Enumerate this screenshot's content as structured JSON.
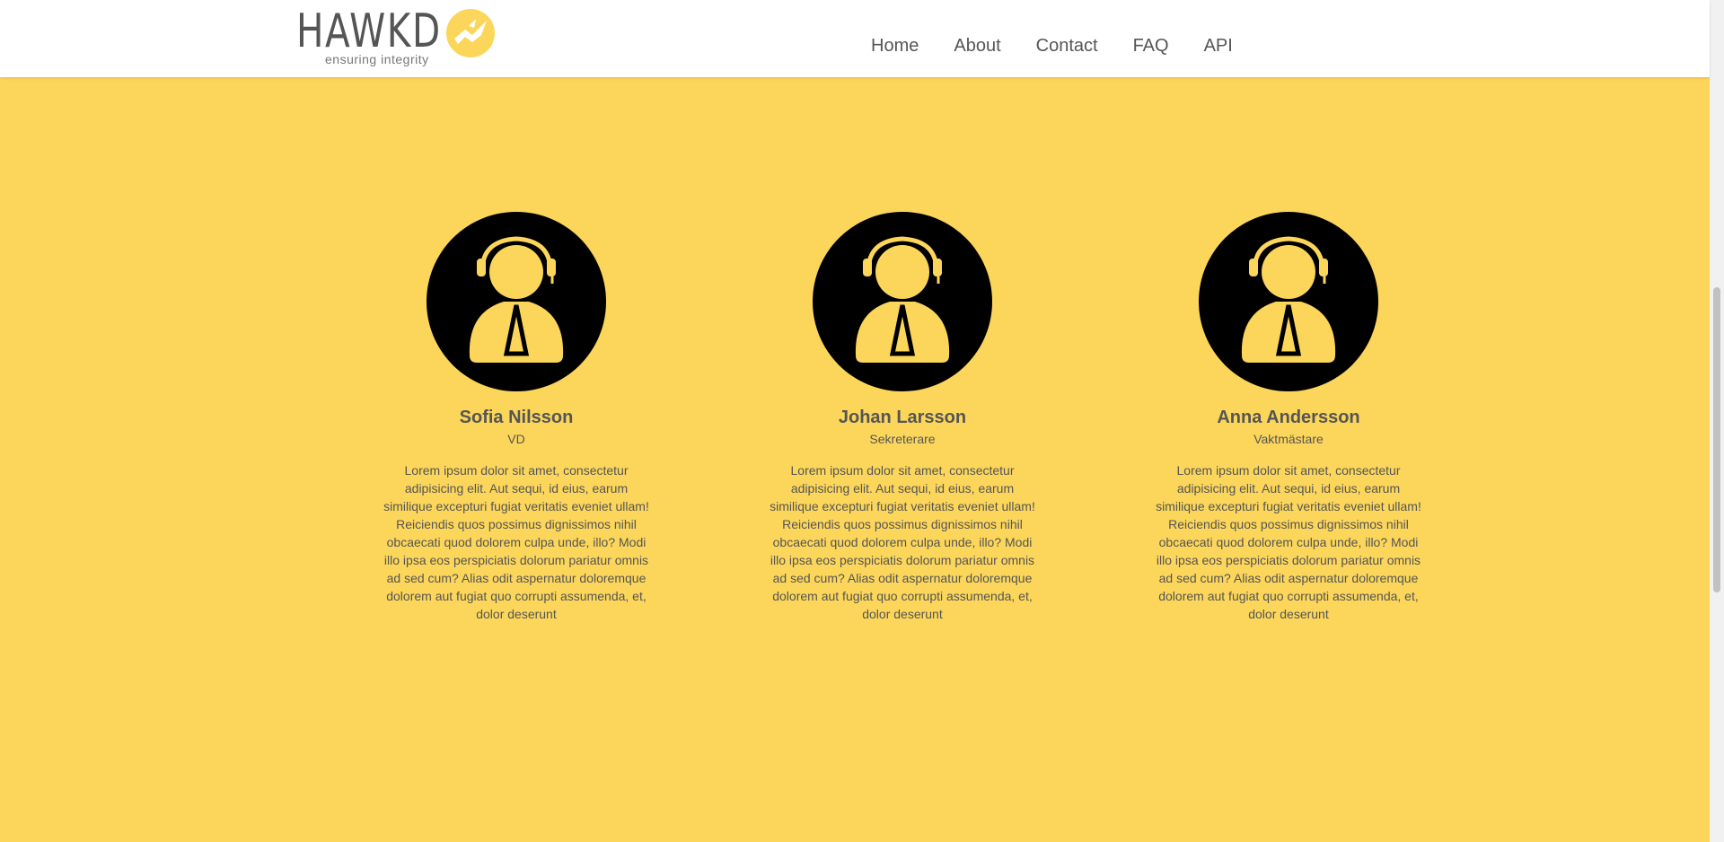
{
  "header": {
    "logo": {
      "name": "HAWKD",
      "tagline": "ensuring integrity"
    },
    "nav": [
      "Home",
      "About",
      "Contact",
      "FAQ",
      "API"
    ]
  },
  "team": [
    {
      "name": "Sofia Nilsson",
      "role": "VD",
      "bio": "Lorem ipsum dolor sit amet, consectetur adipisicing elit. Aut sequi, id eius, earum similique excepturi fugiat veritatis eveniet ullam! Reiciendis quos possimus dignissimos nihil obcaecati quod dolorem culpa unde, illo? Modi illo ipsa eos perspiciatis dolorum pariatur omnis ad sed cum? Alias odit aspernatur doloremque dolorem aut fugiat quo corrupti assumenda, et, dolor deserunt",
      "avatar_icon": "support-agent-icon"
    },
    {
      "name": "Johan Larsson",
      "role": "Sekreterare",
      "bio": "Lorem ipsum dolor sit amet, consectetur adipisicing elit. Aut sequi, id eius, earum similique excepturi fugiat veritatis eveniet ullam! Reiciendis quos possimus dignissimos nihil obcaecati quod dolorem culpa unde, illo? Modi illo ipsa eos perspiciatis dolorum pariatur omnis ad sed cum? Alias odit aspernatur doloremque dolorem aut fugiat quo corrupti assumenda, et, dolor deserunt",
      "avatar_icon": "support-agent-icon"
    },
    {
      "name": "Anna Andersson",
      "role": "Vaktmästare",
      "bio": "Lorem ipsum dolor sit amet, consectetur adipisicing elit. Aut sequi, id eius, earum similique excepturi fugiat veritatis eveniet ullam! Reiciendis quos possimus dignissimos nihil obcaecati quod dolorem culpa unde, illo? Modi illo ipsa eos perspiciatis dolorum pariatur omnis ad sed cum? Alias odit aspernatur doloremque dolorem aut fugiat quo corrupti assumenda, et, dolor deserunt",
      "avatar_icon": "support-agent-icon"
    }
  ],
  "colors": {
    "background": "#fcd65a",
    "accent": "#fcd65a",
    "text": "#555555",
    "avatar_bg": "#000000"
  }
}
